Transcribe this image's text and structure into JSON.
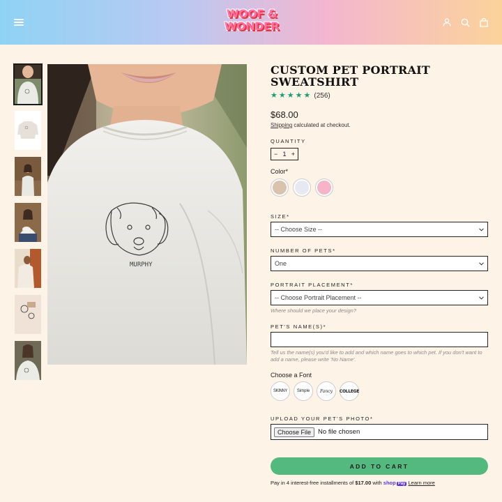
{
  "header": {
    "logo_line1": "WOOF &",
    "logo_line2": "WONDER",
    "icons": [
      "menu-icon",
      "account-icon",
      "search-icon",
      "cart-icon"
    ]
  },
  "product": {
    "title": "CUSTOM PET PORTRAIT SWEATSHIRT",
    "rating": 5,
    "review_count": "(256)",
    "price": "$68.00",
    "shipping_link": "Shipping",
    "shipping_rest": " calculated at checkout.",
    "quantity_label": "QUANTITY",
    "quantity_minus": "−",
    "quantity_value": "1",
    "quantity_plus": "+",
    "color_label": "Color*",
    "colors": [
      "#d9c3ad",
      "#e7e8f0",
      "#f7b3c8"
    ],
    "embroidery_name": "MURPHY"
  },
  "options": {
    "size_label": "SIZE*",
    "size_value": "-- Choose Size --",
    "pets_label": "NUMBER OF PETS*",
    "pets_value": "One",
    "placement_label": "PORTRAIT PLACEMENT*",
    "placement_value": "-- Choose Portrait Placement --",
    "placement_hint": "Where should we place your design?",
    "names_label": "PET'S NAME(S)*",
    "names_hint": "Tell us the name(s) you'd like to add and which name goes to which pet. If you don't want to add a name, please write 'No Name'.",
    "font_label": "Choose a Font",
    "fonts": [
      "SKINNY",
      "Simple",
      "Fancy",
      "COLLEGE"
    ],
    "upload_label": "UPLOAD YOUR PET'S PHOTO*",
    "upload_button": "Choose File",
    "upload_status": "No file chosen"
  },
  "purchase": {
    "cart_button": "ADD TO CART",
    "installments_pre": "Pay in 4 interest-free installments of ",
    "installments_amount": "$17.00",
    "installments_with": " with ",
    "shop_label": "shop",
    "pay_label": "Pay",
    "learn_more": "Learn more"
  }
}
